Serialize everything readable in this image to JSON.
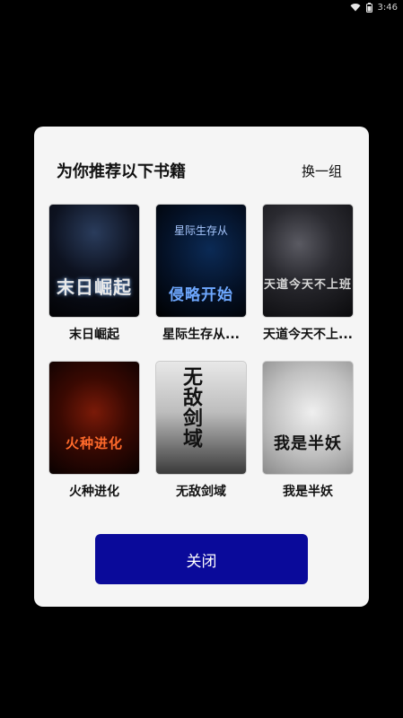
{
  "status_bar": {
    "time": "3:46",
    "icons": [
      "wifi-icon",
      "battery-icon"
    ]
  },
  "dialog": {
    "title": "为你推荐以下书籍",
    "refresh_label": "换一组",
    "close_label": "关闭",
    "colors": {
      "close_button": "#0a0a9a",
      "dialog_bg": "#f5f5f5",
      "backdrop": "#000000"
    },
    "books": [
      {
        "title": "末日崛起",
        "cover_text": "末日崛起"
      },
      {
        "title": "星际生存从...",
        "cover_text": "侵略开始",
        "cover_subtext": "星际生存从"
      },
      {
        "title": "天道今天不上...",
        "cover_text": "天道今天不上班"
      },
      {
        "title": "火种进化",
        "cover_text": "火种进化"
      },
      {
        "title": "无敌剑域",
        "cover_text": "无敌剑域"
      },
      {
        "title": "我是半妖",
        "cover_text": "我是半妖"
      }
    ]
  }
}
